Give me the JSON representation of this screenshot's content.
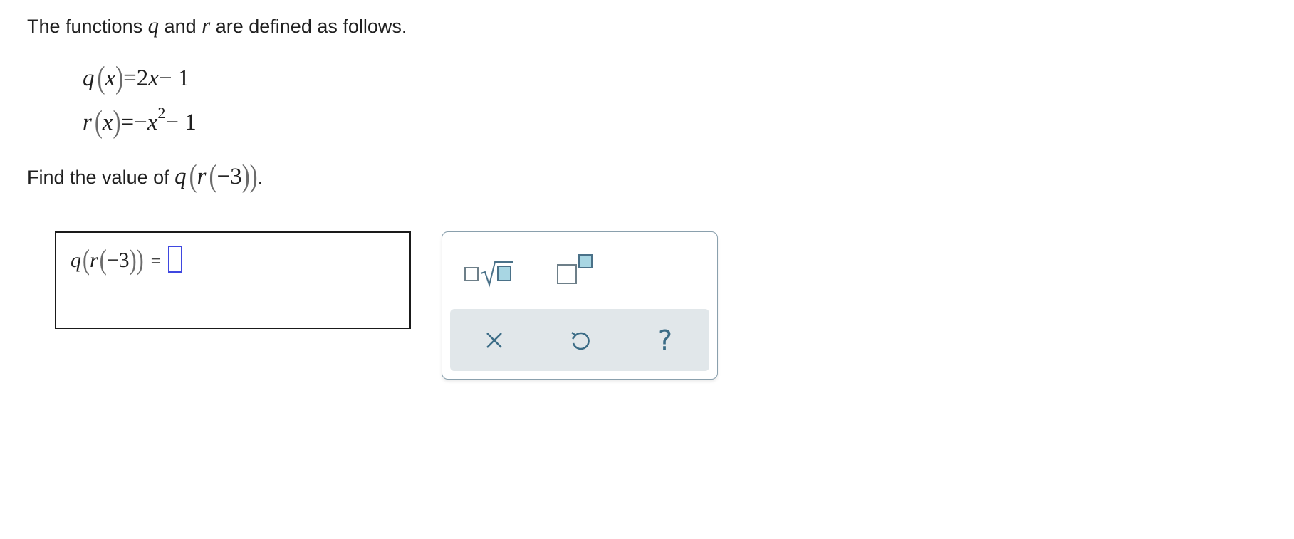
{
  "problem": {
    "intro_before": "The functions ",
    "fn_q": "q",
    "intro_mid": " and ",
    "fn_r": "r",
    "intro_after": " are defined as follows.",
    "def_q_name": "q",
    "def_q_var": "x",
    "def_q_rhs_coef": "=2",
    "def_q_rhs_var": "x",
    "def_q_rhs_tail": "− 1",
    "def_r_name": "r",
    "def_r_var": "x",
    "def_r_rhs_lead": "=−",
    "def_r_rhs_var": "x",
    "def_r_exp": "2",
    "def_r_rhs_tail": "− 1",
    "question_prefix": "Find the value of ",
    "question_q": "q",
    "question_r": "r",
    "question_arg": "−3",
    "question_suffix": "."
  },
  "answer": {
    "q": "q",
    "r": "r",
    "arg": "−3",
    "equals": "=",
    "value": ""
  },
  "palette": {
    "tools": [
      "square-root-template-icon",
      "exponent-template-icon"
    ],
    "actions": [
      "clear-icon",
      "undo-icon",
      "help-icon"
    ],
    "help_glyph": "?"
  },
  "colors": {
    "cursor": "#3f47e0",
    "palette_border": "#8aa0ad",
    "action_bar": "#e1e7ea",
    "icon": "#3b6c86",
    "template_fill": "#a8d6e3"
  }
}
